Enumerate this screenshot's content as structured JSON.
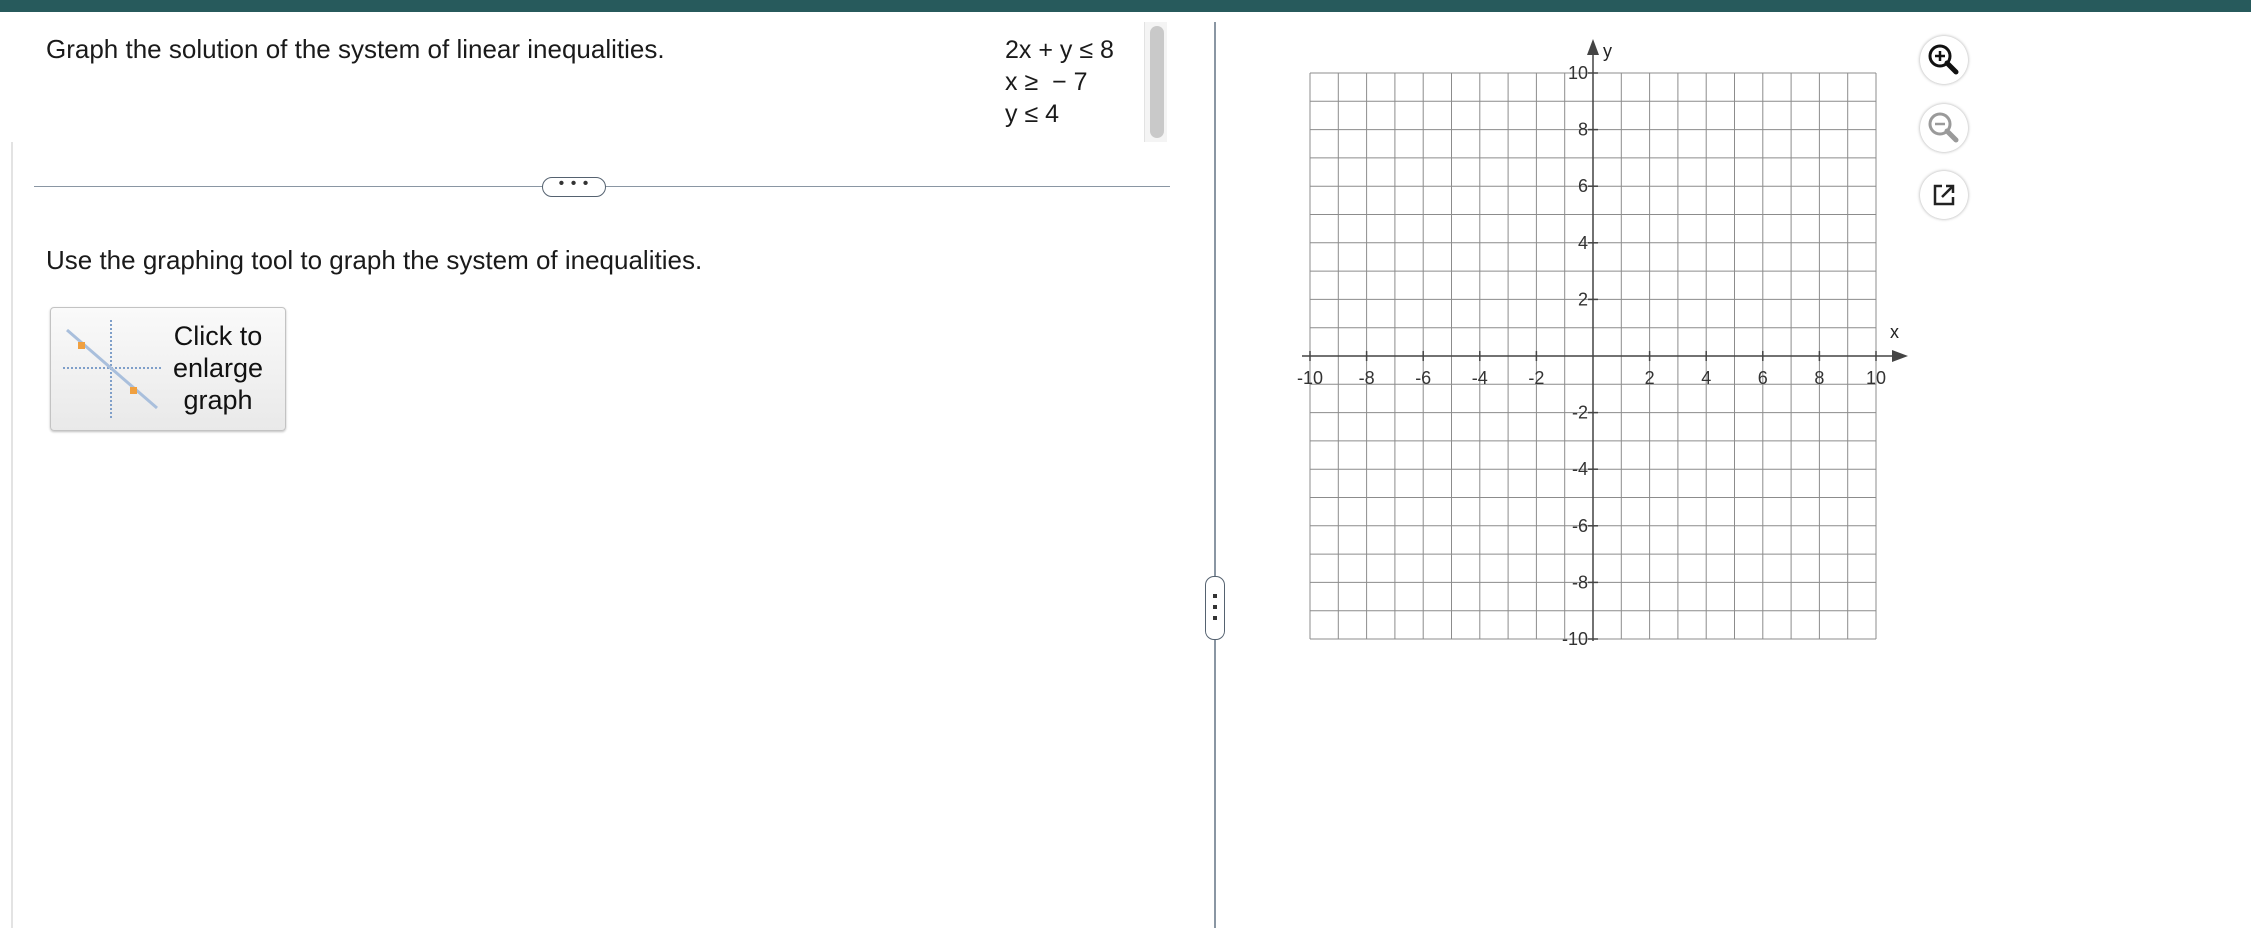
{
  "question": "Graph the solution of the system of linear inequalities.",
  "inequalities": [
    "2x + y ≤ 8",
    "x ≥  − 7",
    "y ≤ 4"
  ],
  "more_button": "• • •",
  "instruction": "Use the graphing tool to graph the system of inequalities.",
  "enlarge_button": {
    "line1": "Click to",
    "line2": "enlarge",
    "line3": "graph"
  },
  "graph": {
    "x_label": "x",
    "y_label": "y",
    "x_ticks": [
      "-10",
      "-8",
      "-6",
      "-4",
      "-2",
      "2",
      "4",
      "6",
      "8",
      "10"
    ],
    "y_ticks": [
      "10",
      "8",
      "6",
      "4",
      "2",
      "-2",
      "-4",
      "-6",
      "-8",
      "-10"
    ],
    "xlim": [
      -10,
      10
    ],
    "ylim": [
      -10,
      10
    ],
    "grid_step": 1,
    "grid": true
  },
  "tools": [
    "zoom-in-icon",
    "zoom-out-icon",
    "popout-icon"
  ],
  "colors": {
    "topbar": "#275a5c",
    "grid": "#8c8c8c",
    "axis": "#444444",
    "zoom_in": "#111111",
    "zoom_out": "#9a9a9a"
  }
}
